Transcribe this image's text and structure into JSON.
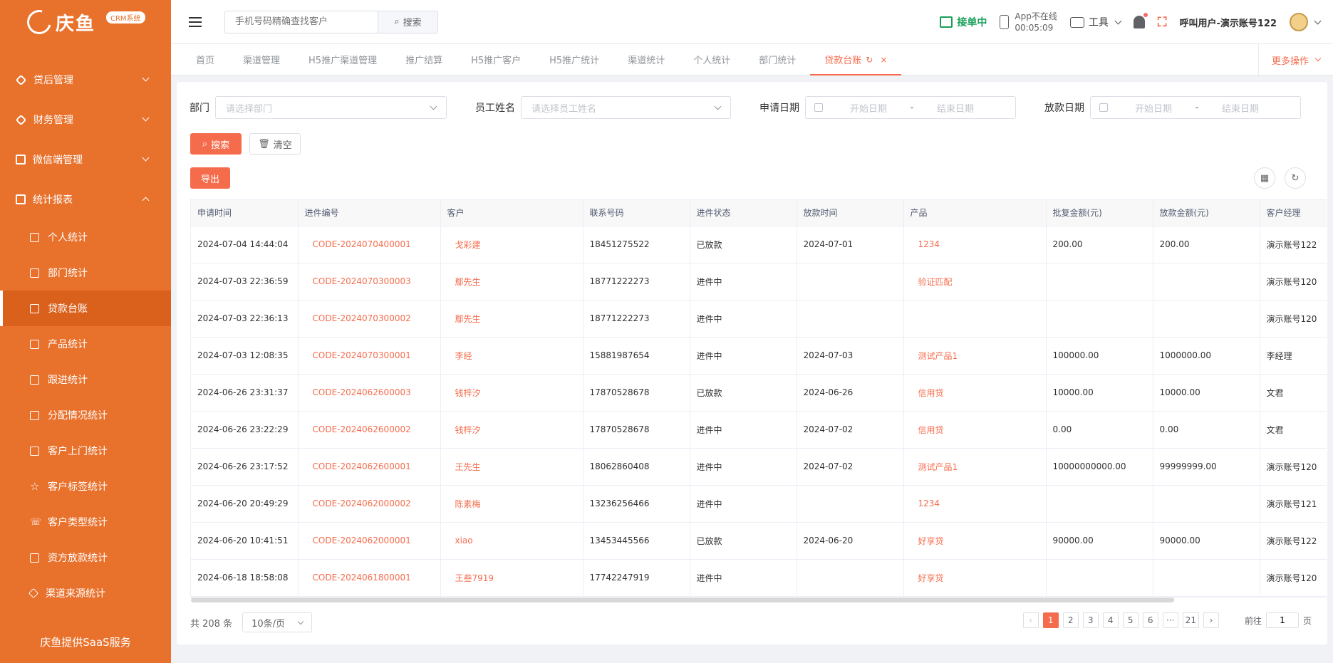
{
  "brand": {
    "name": "庆鱼",
    "tag": "CRM系统"
  },
  "sidebar": {
    "groups": [
      {
        "label": "贷后管理"
      },
      {
        "label": "财务管理"
      },
      {
        "label": "微信端管理"
      },
      {
        "label": "统计报表"
      }
    ],
    "items": [
      {
        "label": "个人统计"
      },
      {
        "label": "部门统计"
      },
      {
        "label": "贷款台账"
      },
      {
        "label": "产品统计"
      },
      {
        "label": "跟进统计"
      },
      {
        "label": "分配情况统计"
      },
      {
        "label": "客户上门统计"
      },
      {
        "label": "客户标签统计"
      },
      {
        "label": "客户类型统计"
      },
      {
        "label": "资方放款统计"
      },
      {
        "label": "渠道来源统计"
      }
    ],
    "footer": "庆鱼提供SaaS服务"
  },
  "header": {
    "search_placeholder": "手机号码精确查找客户",
    "search_label": "搜索",
    "status_label": "接单中",
    "app_status_line1": "App不在线",
    "app_status_line2": "00:05:09",
    "tools_label": "工具",
    "user_label": "呼叫用户-演示账号122"
  },
  "tabs": [
    {
      "label": "首页"
    },
    {
      "label": "渠道管理"
    },
    {
      "label": "H5推广渠道管理"
    },
    {
      "label": "推广结算"
    },
    {
      "label": "H5推广客户"
    },
    {
      "label": "H5推广统计"
    },
    {
      "label": "渠道统计"
    },
    {
      "label": "个人统计"
    },
    {
      "label": "部门统计"
    },
    {
      "label": "贷款台账",
      "close": "×"
    }
  ],
  "more_ops": "更多操作",
  "filters": {
    "dept_label": "部门",
    "dept_placeholder": "请选择部门",
    "staff_label": "员工姓名",
    "staff_placeholder": "请选择员工姓名",
    "apply_label": "申请日期",
    "loan_label": "放款日期",
    "start_placeholder": "开始日期",
    "end_placeholder": "结束日期",
    "range_sep": "-",
    "search_btn": "搜索",
    "clear_btn": "清空",
    "export_btn": "导出"
  },
  "table": {
    "columns": [
      "申请时间",
      "进件编号",
      "客户",
      "联系号码",
      "进件状态",
      "放款时间",
      "产品",
      "批复金额(元)",
      "放款金额(元)",
      "客户经理"
    ],
    "rows": [
      [
        "2024-07-04 14:44:04",
        "CODE-2024070400001",
        "戈彩建",
        "18451275522",
        "已放款",
        "2024-07-01",
        "1234",
        "200.00",
        "200.00",
        "演示账号122"
      ],
      [
        "2024-07-03 22:36:59",
        "CODE-2024070300003",
        "鄢先生",
        "18771222273",
        "进件中",
        "",
        "验证匹配",
        "",
        "",
        "演示账号120"
      ],
      [
        "2024-07-03 22:36:13",
        "CODE-2024070300002",
        "鄢先生",
        "18771222273",
        "进件中",
        "",
        "",
        "",
        "",
        "演示账号120"
      ],
      [
        "2024-07-03 12:08:35",
        "CODE-2024070300001",
        "李经",
        "15881987654",
        "进件中",
        "2024-07-03",
        "测试产品1",
        "100000.00",
        "1000000.00",
        "李经理"
      ],
      [
        "2024-06-26 23:31:37",
        "CODE-2024062600003",
        "钱梓汐",
        "17870528678",
        "已放款",
        "2024-06-26",
        "信用贷",
        "10000.00",
        "10000.00",
        "文君"
      ],
      [
        "2024-06-26 23:22:29",
        "CODE-2024062600002",
        "钱梓汐",
        "17870528678",
        "进件中",
        "2024-07-02",
        "信用贷",
        "0.00",
        "0.00",
        "文君"
      ],
      [
        "2024-06-26 23:17:52",
        "CODE-2024062600001",
        "王先生",
        "18062860408",
        "进件中",
        "2024-07-02",
        "测试产品1",
        "10000000000.00",
        "99999999.00",
        "演示账号120"
      ],
      [
        "2024-06-20 20:49:29",
        "CODE-2024062000002",
        "陈素梅",
        "13236256466",
        "进件中",
        "",
        "1234",
        "",
        "",
        "演示账号121"
      ],
      [
        "2024-06-20 10:41:51",
        "CODE-2024062000001",
        "xiao",
        "13453445566",
        "已放款",
        "2024-06-20",
        "好享贷",
        "90000.00",
        "90000.00",
        "演示账号122"
      ],
      [
        "2024-06-18 18:58:08",
        "CODE-2024061800001",
        "王叁7919",
        "17742247919",
        "进件中",
        "",
        "好享贷",
        "",
        "",
        "演示账号120"
      ]
    ]
  },
  "pagination": {
    "total": "共 208 条",
    "page_size": "10条/页",
    "pages": [
      "1",
      "2",
      "3",
      "4",
      "5",
      "6",
      "···",
      "21"
    ],
    "current": "1",
    "goto_label": "前往",
    "goto_value": "1",
    "page_suffix": "页",
    "prev": "‹",
    "next": "›"
  },
  "colors": {
    "sidebar": "#e8712c",
    "accent": "#f56c4c",
    "active_status": "#18a058"
  }
}
